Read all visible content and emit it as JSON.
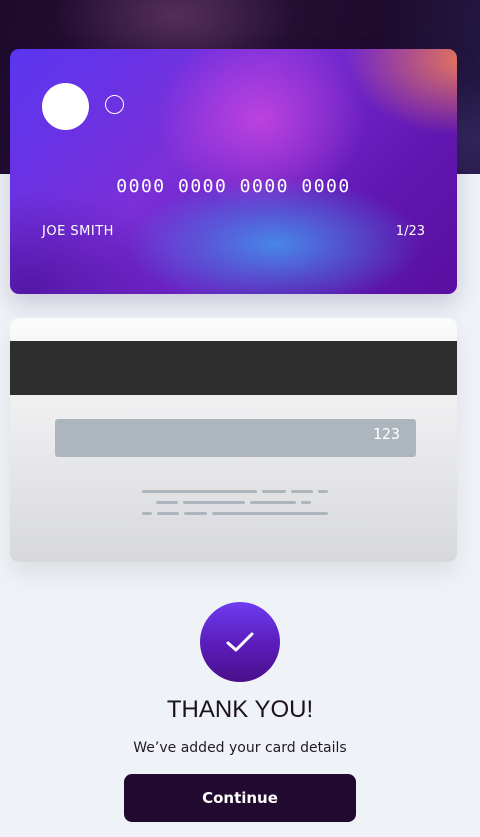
{
  "card_front": {
    "number": "0000 0000 0000 0000",
    "holder_name": "JOE SMITH",
    "expiry": "1/23",
    "logo_icon": "two-circle-card-logo"
  },
  "card_back": {
    "cvc": "123",
    "fine_print_icon": "fine-print-lines"
  },
  "confirmation": {
    "icon": "checkmark-icon",
    "title": "THANK YOU!",
    "message": "We’ve added your card details",
    "button_label": "Continue"
  },
  "colors": {
    "page_background": "#eff2f7",
    "hero_background": "#1e0a2c",
    "button_background": "#21092f",
    "check_gradient_top": "#6f3cf2",
    "check_gradient_bottom": "#4a0f8a"
  }
}
